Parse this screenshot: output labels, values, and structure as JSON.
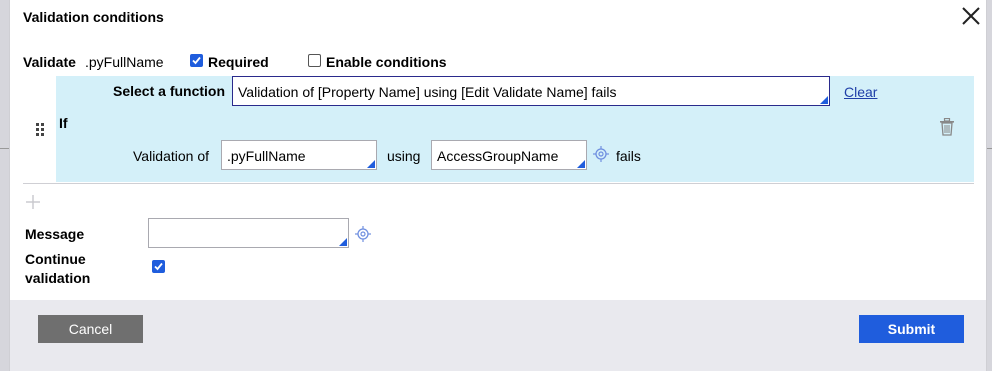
{
  "dialog": {
    "title": "Validation conditions",
    "close_icon": "close-icon"
  },
  "validate": {
    "label": "Validate",
    "property": ".pyFullName",
    "required_label": "Required",
    "required_checked": true,
    "enable_conditions_label": "Enable conditions",
    "enable_conditions_checked": false
  },
  "condition": {
    "if_label": "If",
    "select_function_label": "Select a function",
    "function_value": "Validation of [Property Name] using [Edit Validate Name] fails",
    "clear_label": "Clear",
    "validation_of_label": "Validation of",
    "property_value": ".pyFullName",
    "using_label": "using",
    "edit_validate_value": "AccessGroupName",
    "fails_label": "fails",
    "drag_icon": "drag-handle-icon",
    "delete_icon": "trash-icon",
    "add_icon": "plus-icon",
    "target_icon": "target-icon"
  },
  "message": {
    "label": "Message",
    "value": "",
    "target_icon": "target-icon"
  },
  "continue_validation": {
    "label_line1": "Continue",
    "label_line2": "validation",
    "checked": true
  },
  "footer": {
    "cancel_label": "Cancel",
    "submit_label": "Submit"
  },
  "colors": {
    "accent": "#1f5ddd",
    "panel_bg": "#d4f0f9",
    "cancel_bg": "#6f6f6f",
    "footer_bg": "#e9e9ee"
  }
}
